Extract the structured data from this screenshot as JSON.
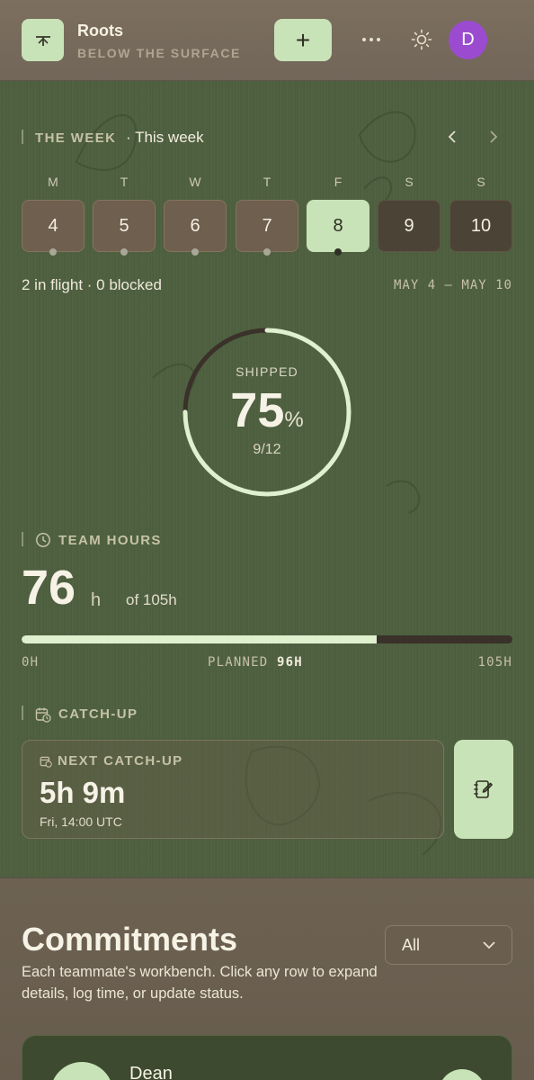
{
  "header": {
    "app_name": "Roots",
    "tagline": "BELOW THE SURFACE",
    "add_label": "+",
    "avatar_initial": "D",
    "avatar_color": "#9b4bd0",
    "accent": "#c9e3b8"
  },
  "week": {
    "section_label": "THE WEEK",
    "current_label": "· This week",
    "prev_icon": "chevron-left-icon",
    "next_icon": "chevron-right-icon",
    "days": [
      {
        "letter": "M",
        "date": "4",
        "dot": true,
        "state": "past"
      },
      {
        "letter": "T",
        "date": "5",
        "dot": true,
        "state": "past"
      },
      {
        "letter": "W",
        "date": "6",
        "dot": true,
        "state": "past"
      },
      {
        "letter": "T",
        "date": "7",
        "dot": true,
        "state": "past"
      },
      {
        "letter": "F",
        "date": "8",
        "dot": true,
        "state": "active"
      },
      {
        "letter": "S",
        "date": "9",
        "dot": false,
        "state": "future"
      },
      {
        "letter": "S",
        "date": "10",
        "dot": false,
        "state": "future"
      }
    ],
    "status": "2 in flight · 0 blocked",
    "range": "MAY 4 – MAY 10"
  },
  "shipped": {
    "label": "SHIPPED",
    "percent_value": "75",
    "percent_sign": "%",
    "fraction": "9/12",
    "progress": 0.75
  },
  "team_hours": {
    "section_label": "TEAM HOURS",
    "value": "76",
    "unit": "h",
    "of_total": "of 105h",
    "progress": 0.7238,
    "min_label": "0H",
    "planned_label": "PLANNED",
    "planned_value": "96H",
    "max_label": "105H"
  },
  "catch_up": {
    "section_label": "CATCH-UP",
    "card_label": "NEXT CATCH-UP",
    "countdown": "5h 9m",
    "when": "Fri, 14:00 UTC"
  },
  "commitments": {
    "title": "Commitments",
    "description": "Each teammate's workbench. Click any row to expand details, log time, or update status.",
    "filter_value": "All",
    "first_person": "Dean"
  }
}
